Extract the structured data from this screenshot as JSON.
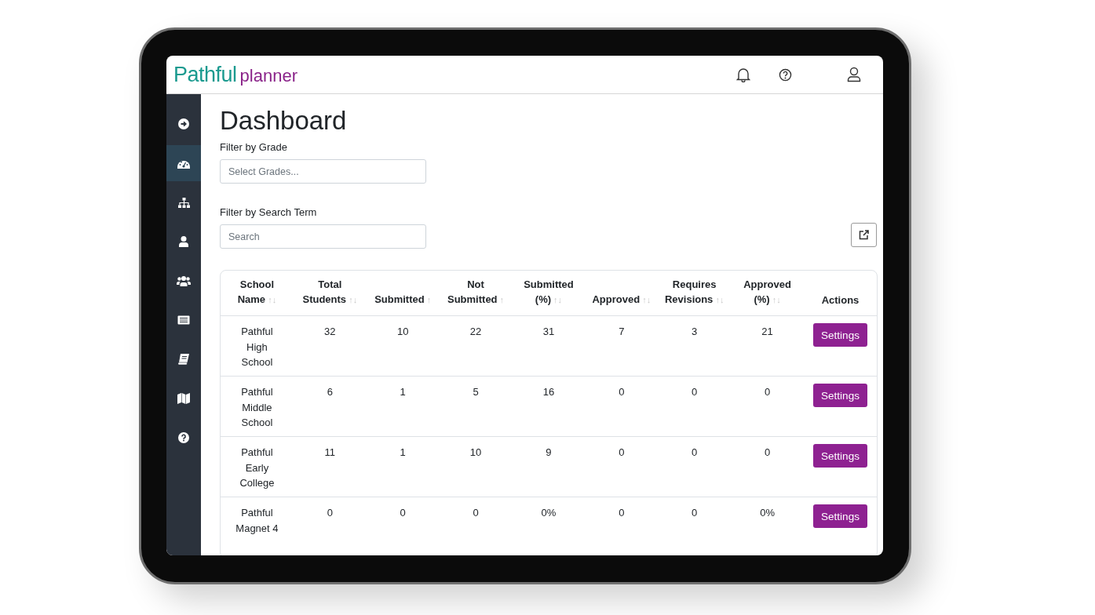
{
  "logo": {
    "brand": "Pathful",
    "product": "planner"
  },
  "sidebar": {
    "items": [
      {
        "selected": false
      },
      {
        "selected": true
      },
      {
        "selected": false
      },
      {
        "selected": false
      },
      {
        "selected": false
      },
      {
        "selected": false
      },
      {
        "selected": false
      },
      {
        "selected": false
      },
      {
        "selected": false
      }
    ]
  },
  "page": {
    "title": "Dashboard",
    "grade_filter": {
      "label": "Filter by Grade",
      "placeholder": "Select Grades..."
    },
    "search_filter": {
      "label": "Filter by Search Term",
      "placeholder": "Search"
    }
  },
  "table": {
    "columns": [
      {
        "label": "School Name",
        "sort": "↑↓"
      },
      {
        "label": "Total Students",
        "sort": "↑↓"
      },
      {
        "label": "Submitted",
        "sort": "↑"
      },
      {
        "label": "Not Submitted",
        "sort": "↑"
      },
      {
        "label": "Submitted (%)",
        "sort": "↑↓"
      },
      {
        "label": "Approved",
        "sort": "↑↓"
      },
      {
        "label": "Requires Revisions",
        "sort": "↑↓"
      },
      {
        "label": "Approved (%)",
        "sort": "↑↓"
      },
      {
        "label": "Actions"
      }
    ],
    "rows": [
      {
        "cells": [
          "Pathful High School",
          "32",
          "10",
          "22",
          "31",
          "7",
          "3",
          "21"
        ],
        "action": "Settings"
      },
      {
        "cells": [
          "Pathful Middle School",
          "6",
          "1",
          "5",
          "16",
          "0",
          "0",
          "0"
        ],
        "action": "Settings"
      },
      {
        "cells": [
          "Pathful Early College",
          "11",
          "1",
          "10",
          "9",
          "0",
          "0",
          "0"
        ],
        "action": "Settings"
      },
      {
        "cells": [
          "Pathful Magnet 4",
          "0",
          "0",
          "0",
          "0%",
          "0",
          "0",
          "0%"
        ],
        "action": "Settings"
      }
    ]
  }
}
